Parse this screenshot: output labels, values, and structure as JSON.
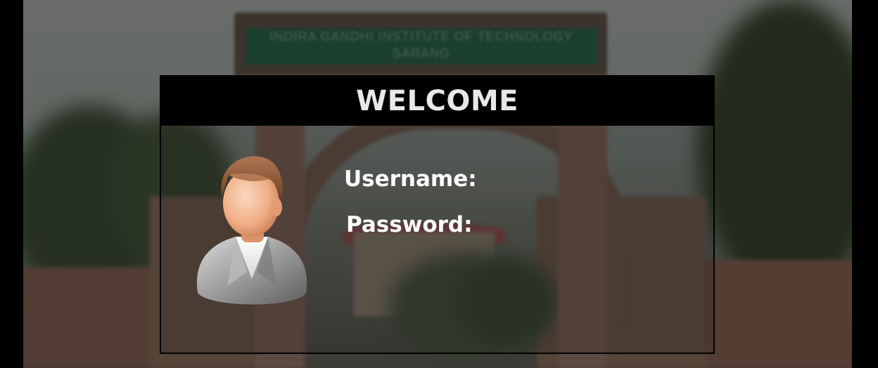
{
  "background": {
    "sign_text": "INDIRA GANDHI INSTITUTE OF TECHNOLOGY SARANG"
  },
  "login_card": {
    "title": "WELCOME",
    "avatar_icon": "user-avatar-icon",
    "username_label": "Username:",
    "username_value": "",
    "password_label": "Password:",
    "password_value": ""
  },
  "colors": {
    "header_bg": "#000000",
    "title_text": "#e8e8e8",
    "label_text": "#ffffff"
  }
}
